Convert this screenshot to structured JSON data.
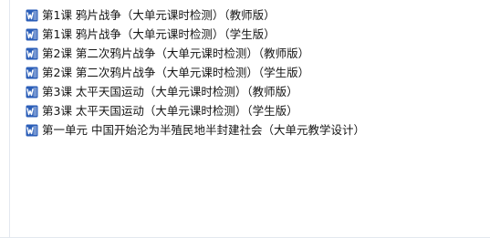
{
  "files": [
    {
      "name": "第1课 鸦片战争（大单元课时检测）（教师版）",
      "icon": "word-doc-icon"
    },
    {
      "name": "第1课 鸦片战争（大单元课时检测）（学生版）",
      "icon": "word-doc-icon"
    },
    {
      "name": "第2课 第二次鸦片战争（大单元课时检测）（教师版）",
      "icon": "word-doc-icon"
    },
    {
      "name": "第2课 第二次鸦片战争（大单元课时检测）（学生版）",
      "icon": "word-doc-icon"
    },
    {
      "name": "第3课 太平天国运动（大单元课时检测）（教师版）",
      "icon": "word-doc-icon"
    },
    {
      "name": "第3课 太平天国运动（大单元课时检测）（学生版）",
      "icon": "word-doc-icon"
    },
    {
      "name": "第一单元 中国开始沦为半殖民地半封建社会（大单元教学设计）",
      "icon": "word-doc-icon"
    }
  ],
  "colors": {
    "icon_blue": "#2b5eb8",
    "icon_light": "#ffffff"
  }
}
